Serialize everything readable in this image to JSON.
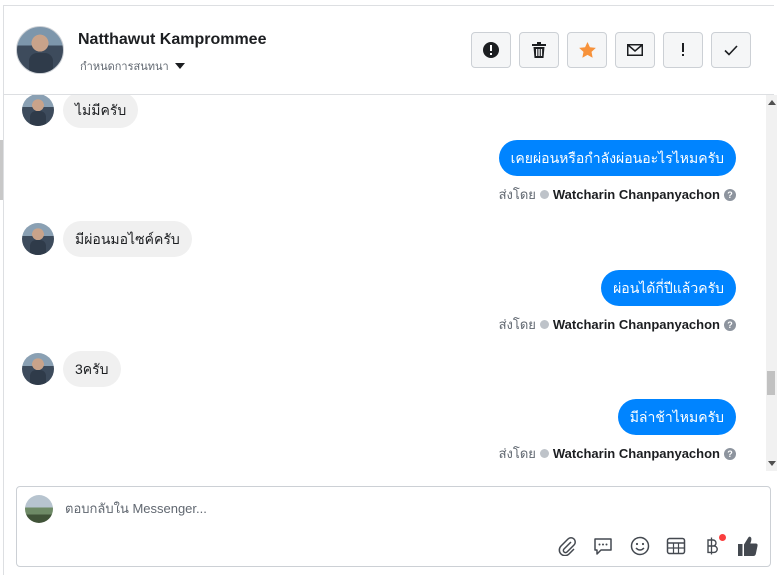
{
  "header": {
    "contact_name": "Natthawut Kamprommee",
    "assign_label": "กำหนดการสนทนา",
    "tools": [
      {
        "name": "report-button",
        "icon": "exclamation-circle-icon"
      },
      {
        "name": "delete-button",
        "icon": "trash-icon"
      },
      {
        "name": "star-button",
        "icon": "star-icon"
      },
      {
        "name": "mark-unread-button",
        "icon": "envelope-icon"
      },
      {
        "name": "follow-up-button",
        "icon": "exclamation-icon"
      },
      {
        "name": "done-button",
        "icon": "checkmark-icon"
      }
    ],
    "star_color": "#f7923b"
  },
  "messages": [
    {
      "dir": "in",
      "text": "ไม่มีครับ"
    },
    {
      "dir": "out",
      "text": "เคยผ่อนหรือกำลังผ่อนอะไรไหมครับ",
      "sent_by_label": "ส่งโดย",
      "sender": "Watcharin Chanpanyachon"
    },
    {
      "dir": "in",
      "text": "มีผ่อนมอไซค์ครับ"
    },
    {
      "dir": "out",
      "text": "ผ่อนได้กี่ปีแล้วครับ",
      "sent_by_label": "ส่งโดย",
      "sender": "Watcharin Chanpanyachon"
    },
    {
      "dir": "in",
      "text": "3ครับ"
    },
    {
      "dir": "out",
      "text": "มีล่าช้าไหมครับ",
      "sent_by_label": "ส่งโดย",
      "sender": "Watcharin Chanpanyachon"
    }
  ],
  "composer": {
    "placeholder": "ตอบกลับใน Messenger...",
    "tools": [
      "paperclip-icon",
      "chat-bubble-icon",
      "smiley-icon",
      "table-icon",
      "baht-icon",
      "thumbs-up-icon"
    ]
  },
  "colors": {
    "accent": "#0084ff",
    "incoming_bubble": "#f0f0f0",
    "notification": "#fa3e3e"
  }
}
